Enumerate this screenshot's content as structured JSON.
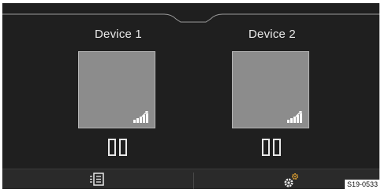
{
  "devices": [
    {
      "label": "Device 1",
      "state": "paused",
      "icon": "signal-strength-icon"
    },
    {
      "label": "Device 2",
      "state": "paused",
      "icon": "signal-strength-icon"
    }
  ],
  "bottom_bar": {
    "left_button_icon": "list-menu-icon",
    "right_button_icon": "settings-gear-icon"
  },
  "figure_code": "S19-0533",
  "colors": {
    "background": "#1f1f1f",
    "tile": "#8c8c8c",
    "text": "#e8e8e8",
    "accent": "#e0a030"
  }
}
